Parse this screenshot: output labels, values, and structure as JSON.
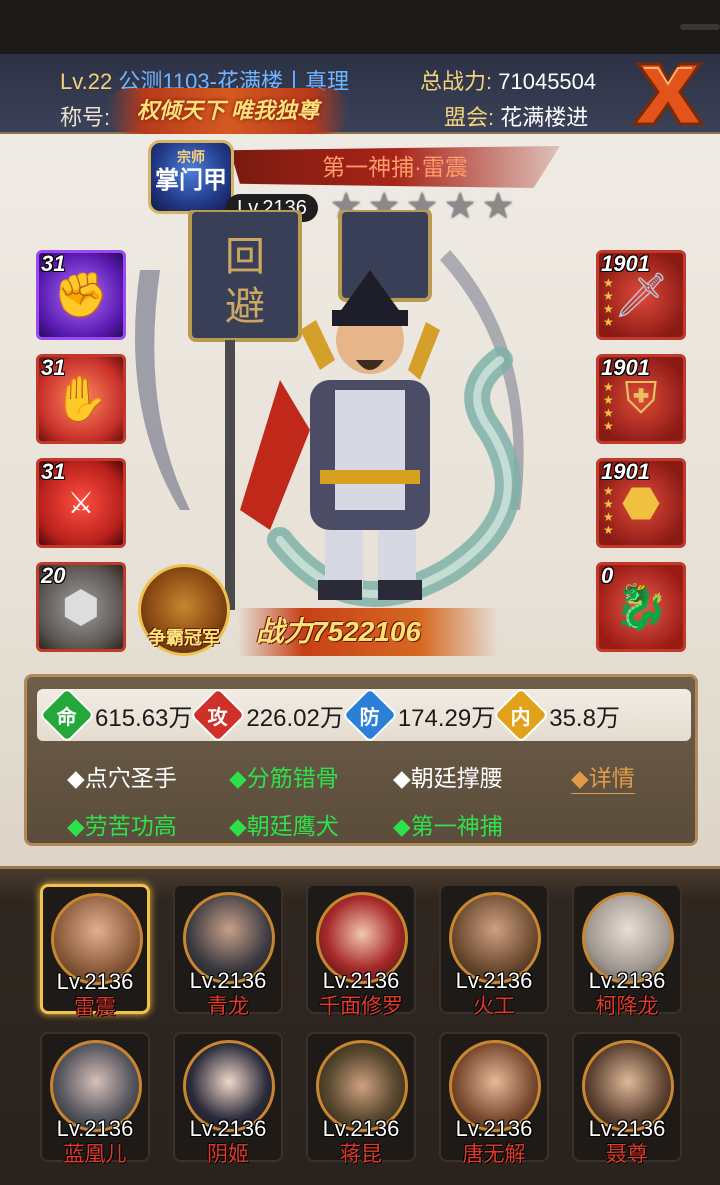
{
  "header": {
    "level": "Lv.22",
    "server": "公测1103-花满楼丨真理",
    "title_label": "称号:",
    "title_banner": "权倾天下 唯我独尊",
    "total_power_label": "总战力:",
    "total_power": "71045504",
    "guild_label": "盟会:",
    "guild": "花满楼进"
  },
  "hero": {
    "master_badge_top": "宗师",
    "master_badge": "掌门甲",
    "name": "第一神捕·雷震",
    "level": "Lv.2136",
    "stars_filled": 0,
    "stars_total": 5,
    "combat_power": "战力7522106",
    "champion_badge": "争霸冠军"
  },
  "skills_left": [
    {
      "level": "31",
      "color": "#6a2acb"
    },
    {
      "level": "31",
      "color": "#c8302a"
    },
    {
      "level": "31",
      "color": "#b8201c"
    },
    {
      "level": "20",
      "color": "#6a6560"
    }
  ],
  "equipment_right": [
    {
      "level": "1901"
    },
    {
      "level": "1901"
    },
    {
      "level": "1901"
    },
    {
      "level": "0"
    }
  ],
  "stats": [
    {
      "label": "命",
      "value": "615.63万",
      "color": "#23a83a"
    },
    {
      "label": "攻",
      "value": "226.02万",
      "color": "#d0302a"
    },
    {
      "label": "防",
      "value": "174.29万",
      "color": "#2a7fd8"
    },
    {
      "label": "内",
      "value": "35.8万",
      "color": "#e0a21a"
    }
  ],
  "traits": [
    {
      "text": "◆点穴圣手",
      "style": "white"
    },
    {
      "text": "◆分筋错骨",
      "style": "green"
    },
    {
      "text": "◆朝廷撑腰",
      "style": "white"
    },
    {
      "text": "◆详情",
      "style": "link"
    },
    {
      "text": "◆劳苦功高",
      "style": "green"
    },
    {
      "text": "◆朝廷鹰犬",
      "style": "green"
    },
    {
      "text": "◆第一神捕",
      "style": "green"
    }
  ],
  "roster": [
    {
      "level": "Lv.2136",
      "name": "雷震",
      "active": true
    },
    {
      "level": "Lv.2136",
      "name": "青龙"
    },
    {
      "level": "Lv.2136",
      "name": "千面修罗"
    },
    {
      "level": "Lv.2136",
      "name": "火工"
    },
    {
      "level": "Lv.2136",
      "name": "柯降龙"
    },
    {
      "level": "Lv.2136",
      "name": "蓝凰儿"
    },
    {
      "level": "Lv.2136",
      "name": "阴姬"
    },
    {
      "level": "Lv.2136",
      "name": "蒋昆"
    },
    {
      "level": "Lv.2136",
      "name": "唐无解"
    },
    {
      "level": "Lv.2136",
      "name": "聂尊"
    }
  ],
  "colors": {
    "header_bg": "#2c3144",
    "gold": "#f2d27a",
    "server_blue": "#6fb5ff",
    "trait_green": "#2ee04a",
    "name_red": "#e23a2a"
  }
}
